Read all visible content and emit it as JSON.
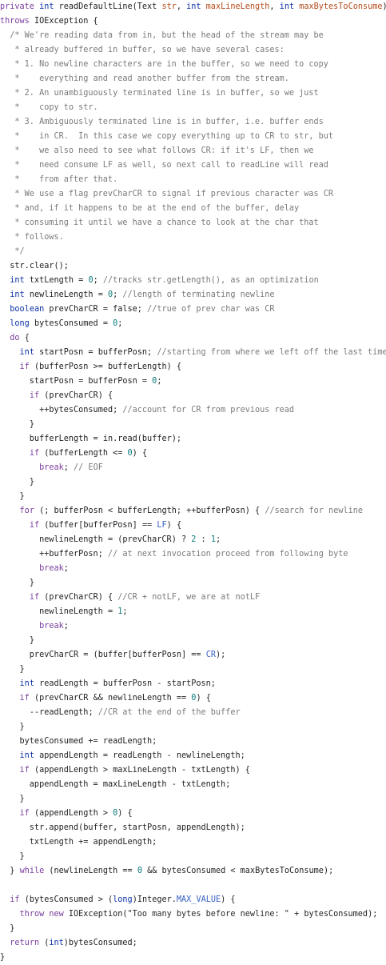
{
  "code_lines": [
    "private int readDefaultLine(Text str, int maxLineLength, int maxBytesToConsume)",
    "throws IOException {",
    "  /* We're reading data from in, but the head of the stream may be",
    "   * already buffered in buffer, so we have several cases:",
    "   * 1. No newline characters are in the buffer, so we need to copy",
    "   *    everything and read another buffer from the stream.",
    "   * 2. An unambiguously terminated line is in buffer, so we just",
    "   *    copy to str.",
    "   * 3. Ambiguously terminated line is in buffer, i.e. buffer ends",
    "   *    in CR.  In this case we copy everything up to CR to str, but",
    "   *    we also need to see what follows CR: if it's LF, then we",
    "   *    need consume LF as well, so next call to readLine will read",
    "   *    from after that.",
    "   * We use a flag prevCharCR to signal if previous character was CR",
    "   * and, if it happens to be at the end of the buffer, delay",
    "   * consuming it until we have a chance to look at the char that",
    "   * follows.",
    "   */",
    "  str.clear();",
    "  int txtLength = 0; //tracks str.getLength(), as an optimization",
    "  int newlineLength = 0; //length of terminating newline",
    "  boolean prevCharCR = false; //true of prev char was CR",
    "  long bytesConsumed = 0;",
    "  do {",
    "    int startPosn = bufferPosn; //starting from where we left off the last time",
    "    if (bufferPosn >= bufferLength) {",
    "      startPosn = bufferPosn = 0;",
    "      if (prevCharCR) {",
    "        ++bytesConsumed; //account for CR from previous read",
    "      }",
    "      bufferLength = in.read(buffer);",
    "      if (bufferLength <= 0) {",
    "        break; // EOF",
    "      }",
    "    }",
    "    for (; bufferPosn < bufferLength; ++bufferPosn) { //search for newline",
    "      if (buffer[bufferPosn] == LF) {",
    "        newlineLength = (prevCharCR) ? 2 : 1;",
    "        ++bufferPosn; // at next invocation proceed from following byte",
    "        break;",
    "      }",
    "      if (prevCharCR) { //CR + notLF, we are at notLF",
    "        newlineLength = 1;",
    "        break;",
    "      }",
    "      prevCharCR = (buffer[bufferPosn] == CR);",
    "    }",
    "    int readLength = bufferPosn - startPosn;",
    "    if (prevCharCR && newlineLength == 0) {",
    "      --readLength; //CR at the end of the buffer",
    "    }",
    "    bytesConsumed += readLength;",
    "    int appendLength = readLength - newlineLength;",
    "    if (appendLength > maxLineLength - txtLength) {",
    "      appendLength = maxLineLength - txtLength;",
    "    }",
    "    if (appendLength > 0) {",
    "      str.append(buffer, startPosn, appendLength);",
    "      txtLength += appendLength;",
    "    }",
    "  } while (newlineLength == 0 && bytesConsumed < maxBytesToConsume);",
    "",
    "  if (bytesConsumed > (long)Integer.MAX_VALUE) {",
    "    throw new IOException(\"Too many bytes before newline: \" + bytesConsumed);",
    "  }",
    "  return (int)bytesConsumed;",
    "}"
  ],
  "colors": {
    "background": "#ffffff",
    "text": "#1f1f1f",
    "keyword": "#7a3e9d",
    "type_keyword": "#0b32a6",
    "comment": "#7a7a7a",
    "number": "#0c7b7b",
    "parameter": "#b34b1a",
    "constant": "#3760c5"
  }
}
